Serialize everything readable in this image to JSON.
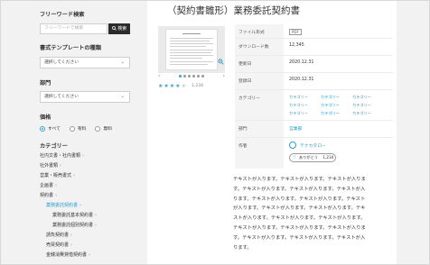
{
  "sidebar": {
    "free_word_heading": "フリーワード検索",
    "search_placeholder": "フリーワードで検索",
    "search_button_label": "検索",
    "template_type_heading": "書式テンプレートの種類",
    "template_type_select": "選択してください",
    "department_heading": "部門",
    "department_select": "選択してください",
    "price_heading": "価格",
    "price_options": [
      "すべて",
      "有料",
      "無料"
    ],
    "category_heading": "カテゴリー",
    "categories": [
      "社内文書・社内書類",
      "社外書類",
      "営業・販売書式",
      "企画書",
      "契約書",
      "業務委託契約書",
      "業務委託基本契約書",
      "業務委託個別契約書",
      "請負契約書",
      "売買契約書",
      "金銭消費貸借契約書"
    ]
  },
  "main": {
    "title": "（契約書雛形）業務委託契約書",
    "rating_count": "1,234",
    "rating_value": 4,
    "rating_max": 5,
    "info": {
      "file_format_label": "ファイル形式",
      "file_format_value": "PDF",
      "downloads_label": "ダウンロード数",
      "downloads_value": "12,345",
      "updated_label": "更新日",
      "updated_value": "2020.12.31",
      "registered_label": "登録日",
      "registered_value": "2020.12.31",
      "category_label": "カテゴリー",
      "category_links": [
        "カテゴリー",
        "カテゴリー",
        "カテゴリー",
        "カテゴリー",
        "カテゴリー",
        "カテゴリー",
        "カテゴリー",
        "カテゴリー",
        "カテゴリー"
      ],
      "department_label": "部門",
      "department_value": "営業部",
      "author_label": "作者",
      "author_name": "テナカタロー",
      "like_label": "ありがとう",
      "like_count": "1,234"
    },
    "body_lines": [
      "テキストが入ります。テキストが入ります。テキストが入りま",
      "す。テキストが入ります。テキストが入ります。テキストが入",
      "ります。テキストが入ります。テキストが入ります。テキスト",
      "が入ります。テキストが入ります。テキストが入ります。テキ",
      "ストが入ります。テキストが入ります。テキストが入ります。",
      "テキストが入ります。テキストが入ります。テキストが入りま",
      "す。テキストが入ります。テキストが入ります。テキストが入",
      "ります。"
    ]
  },
  "colors": {
    "accent": "#2a9ed0",
    "search_button": "#2b2b2b",
    "page_bg": "#f2f2f2"
  }
}
